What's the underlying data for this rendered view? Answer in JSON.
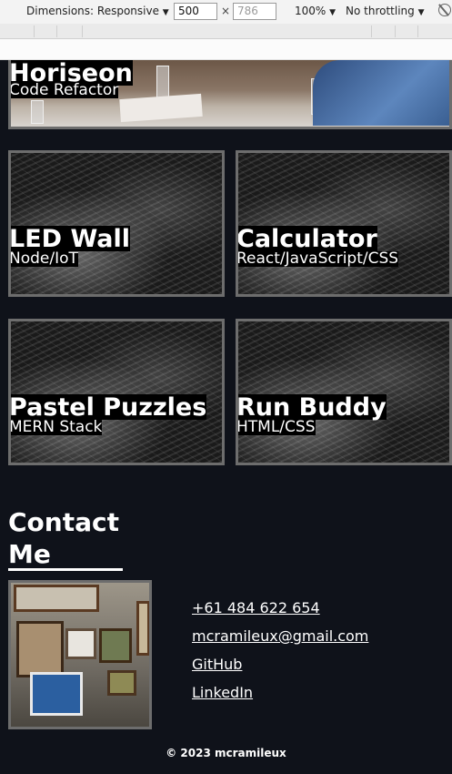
{
  "devtools": {
    "dimensions_label": "Dimensions: Responsive",
    "width_value": "500",
    "height_placeholder": "786",
    "times": "×",
    "zoom": "100%",
    "throttling": "No throttling",
    "caret": "▼"
  },
  "hero": {
    "title": "Horiseon",
    "subtitle": "Code Refactor"
  },
  "projects": [
    {
      "title": "LED Wall",
      "subtitle": "Node/IoT"
    },
    {
      "title": "Calculator",
      "subtitle": "React/JavaScript/CSS"
    },
    {
      "title": "Pastel Puzzles",
      "subtitle": "MERN Stack"
    },
    {
      "title": "Run Buddy",
      "subtitle": "HTML/CSS"
    }
  ],
  "contact": {
    "heading": "Contact Me",
    "phone": "+61 484 622 654",
    "email": "mcramileux@gmail.com",
    "github": "GitHub",
    "linkedin": "LinkedIn"
  },
  "footer": {
    "copyright": "© 2023 mcramileux"
  },
  "colors": {
    "page_bg": "#0f121a",
    "card_border": "#6d6d6d",
    "text": "#ffffff"
  }
}
